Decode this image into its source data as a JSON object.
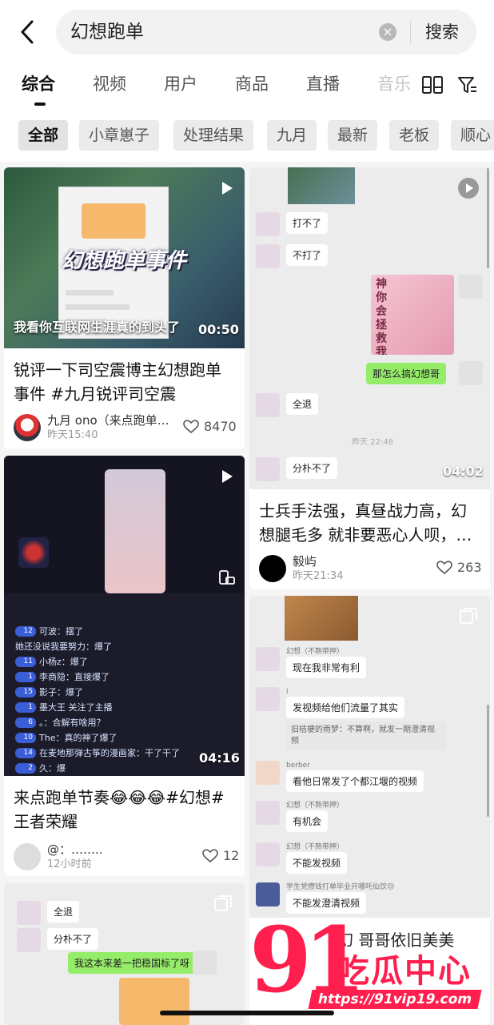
{
  "search": {
    "query": "幻想跑单",
    "button": "搜索"
  },
  "tabs": [
    "综合",
    "视频",
    "用户",
    "商品",
    "直播",
    "音乐"
  ],
  "chips": [
    "全部",
    "小章崽子",
    "处理结果",
    "九月",
    "最新",
    "老板",
    "顺心"
  ],
  "cards": [
    {
      "overlay_title": "幻想跑单事件",
      "subtitle": "我看你互联网生涯真的到头了",
      "duration": "00:50",
      "title": "锐评一下司空震博主幻想跑单事件 #九月锐评司空震",
      "author": "九月 ono（来点跑单…",
      "time": "昨天15:40",
      "likes": "8470"
    },
    {
      "duration": "04:02",
      "title": "士兵手法强，真昼战力高，幻想腿毛多 就非要恶心人呗，…",
      "author": "毅屿",
      "time": "昨天21:34",
      "likes": "263",
      "chat": [
        "打不了",
        "不打了",
        "神你会拯救我吗",
        "那怎么搞幻想哥",
        "全退",
        "分朴不了"
      ],
      "chat_time": "昨天 22:48"
    },
    {
      "duration": "04:16",
      "title": "来点跑单节奏😂😂😂#幻想#王者荣耀",
      "author": "@：……..",
      "time": "12小时前",
      "likes": "12",
      "comments": [
        {
          "lvl": "12",
          "text": "可波：摆了"
        },
        {
          "lvl": "",
          "text": "她还没说我要努力：爆了"
        },
        {
          "lvl": "11",
          "text": "小杨z：爆了"
        },
        {
          "lvl": "1",
          "text": "李商隐：直接爆了"
        },
        {
          "lvl": "15",
          "text": "影子：爆了"
        },
        {
          "lvl": "1",
          "text": "墨大王 关注了主播"
        },
        {
          "lvl": "6",
          "text": "。：合解有啥用？"
        },
        {
          "lvl": "10",
          "text": "The：真的神了爆了"
        },
        {
          "lvl": "14",
          "text": "在麦地那弹古筝的漫画家：干了干了"
        },
        {
          "lvl": "2",
          "text": "久：爆"
        }
      ]
    },
    {
      "chat": [
        {
          "name": "幻想（不熟带押）",
          "text": "现在我非常有利"
        },
        {
          "name": "i",
          "text": "发视频给他们流量了其实",
          "quote": "旧桔梗的雨梦：不算啊，就发一期澄清视频"
        },
        {
          "name": "berber",
          "text": "看他日常发了个都江堰的视频"
        },
        {
          "name": "幻想（不熟带押）",
          "text": "有机会"
        },
        {
          "name": "幻想（不熟带押）",
          "text": "不能发视频"
        },
        {
          "name": "学生党攒钱打单毕业开哪吒仙饮😊",
          "text": "不能发澄清视频"
        }
      ],
      "footer_text": "幻 哥哥依旧美美"
    },
    {
      "chat": [
        "全退",
        "分朴不了",
        "我这本来差一把稳国标了呀"
      ]
    }
  ],
  "watermark": {
    "number": "91",
    "text": "吃瓜中心",
    "url": "https://91vip19.com"
  },
  "colors": {
    "accent": "#ff1f4e",
    "wechat_green": "#95ec69"
  }
}
